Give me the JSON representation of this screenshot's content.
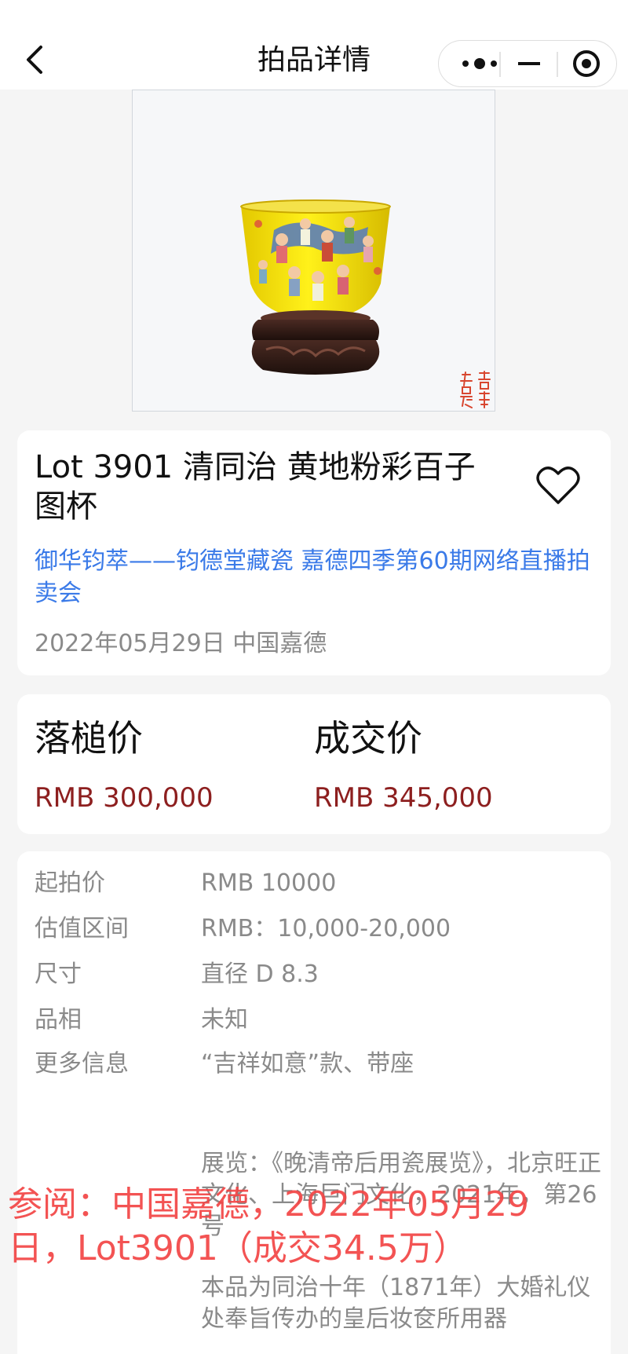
{
  "nav": {
    "title": "拍品详情",
    "back_icon": "back-chevron-icon",
    "more_icon": "more-dots-icon",
    "minimize_icon": "minimize-icon",
    "close_icon": "target-circle-icon"
  },
  "photo": {
    "seal_text": "吉祥如意"
  },
  "lot": {
    "title": "Lot 3901 清同治 黄地粉彩百子图杯",
    "session": "御华钧萃——钧德堂藏瓷 嘉德四季第60期网络直播拍卖会",
    "meta": "2022年05月29日 中国嘉德",
    "favorite_icon": "heart-icon"
  },
  "prices": {
    "hammer_label": "落槌价",
    "hammer_value": "RMB 300,000",
    "deal_label": "成交价",
    "deal_value": "RMB 345,000"
  },
  "specs": [
    {
      "key": "起拍价",
      "value": "RMB 10000"
    },
    {
      "key": "估值区间",
      "value": "RMB：10,000-20,000"
    },
    {
      "key": "尺寸",
      "value": "直径 D 8.3"
    },
    {
      "key": "品相",
      "value": "未知"
    },
    {
      "key": "更多信息",
      "value": "“吉祥如意”款、带座"
    }
  ],
  "more_info": {
    "exhibition": "展览：《晚清帝后用瓷展览》，北京旺正文化、上海巨门文化，2021年，第26号",
    "note": "本品为同治十年（1871年）大婚礼仪处奉旨传办的皇后妆奁所用器"
  },
  "watermark": "参阅：中国嘉德，2022年05月29日，Lot3901（成交34.5万）",
  "colors": {
    "link_blue": "#3a7ae8",
    "price_red": "#8d1f1f",
    "watermark_red": "#f24545"
  }
}
